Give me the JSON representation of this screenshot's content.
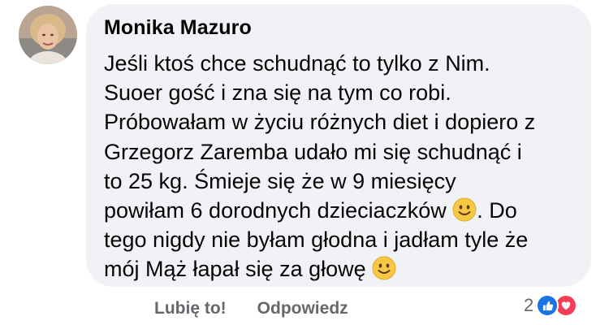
{
  "comment": {
    "author": "Monika Mazuro",
    "lines": [
      {
        "text": "Jeśli ktoś chce schudnąć to tylko z Nim."
      },
      {
        "text": "Suoer gość i zna się na tym co robi."
      },
      {
        "text": "Próbowałam w życiu różnych diet i dopiero z"
      },
      {
        "text": "Grzegorz Zaremba udało mi się schudnąć i"
      },
      {
        "text": "to 25 kg. Śmieje się że w 9 miesięcy"
      },
      {
        "text": "powiłam 6 dorodnych dzieciaczków",
        "emoji": "slightly-smiling-face",
        "after": ". Do"
      },
      {
        "text": "tego nigdy nie byłam głodna i jadłam tyle że"
      },
      {
        "text": "mój Mąż łapał się za głowę",
        "emoji": "slightly-smiling-face"
      }
    ]
  },
  "actions": {
    "like_label": "Lubię to!",
    "reply_label": "Odpowiedz"
  },
  "reactions": {
    "count": "2",
    "types": [
      "like-icon",
      "love-icon"
    ],
    "colors": {
      "like": "#1b74e4",
      "love": "#f33e58"
    }
  },
  "colors": {
    "bubble_bg": "#f0f2f5",
    "text": "#050505",
    "secondary_text": "#65676b",
    "emoji_face": "#f7c843"
  }
}
